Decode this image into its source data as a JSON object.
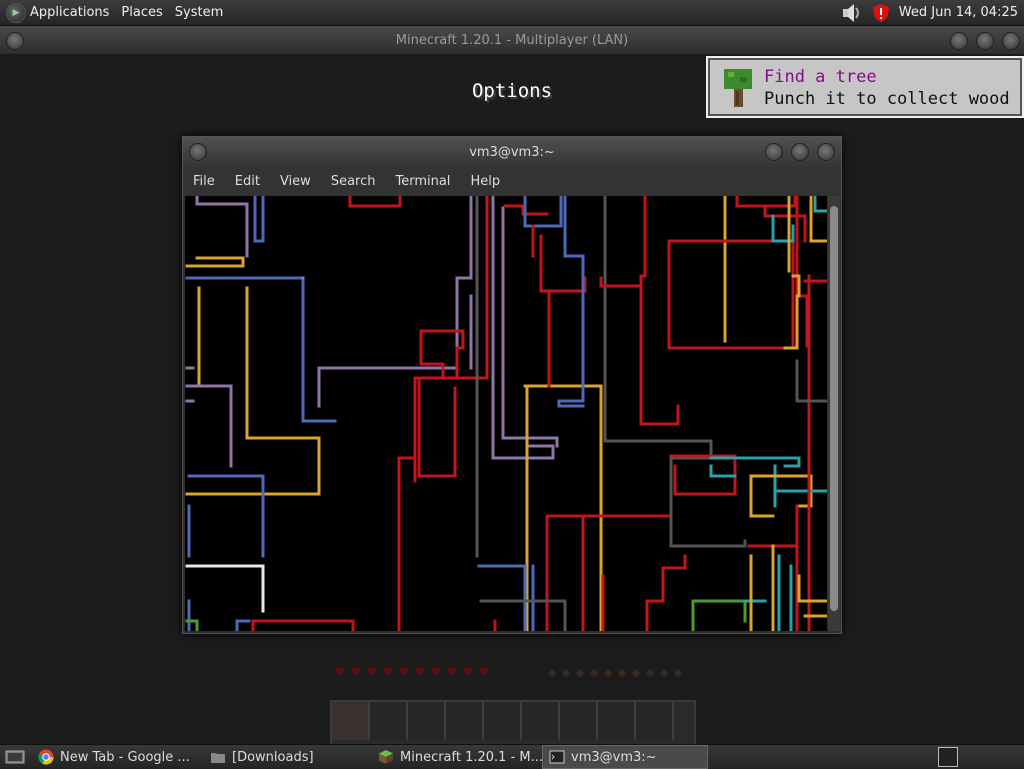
{
  "top_panel": {
    "menus": [
      "Applications",
      "Places",
      "System"
    ],
    "clock": "Wed Jun 14, 04:25",
    "icons": [
      "volume-icon",
      "update-shield-icon"
    ]
  },
  "minecraft_window": {
    "title": "Minecraft 1.20.1 - Multiplayer (LAN)",
    "screen_title": "Options",
    "toast": {
      "title": "Find a tree",
      "subtitle": "Punch it to collect wood"
    },
    "hotbar_slots": 9,
    "colors": {
      "toast_title": "#8a0b8a",
      "bg": "#1d1c1c"
    }
  },
  "terminal": {
    "title": "vm3@vm3:~",
    "menus": [
      "File",
      "Edit",
      "View",
      "Search",
      "Terminal",
      "Help"
    ],
    "colors": [
      "#c0151d",
      "#d8a530",
      "#4d69b8",
      "#8f76a8",
      "#2aa0a8",
      "#e8e8e8",
      "#4e9a2e",
      "#555555"
    ]
  },
  "taskbar": {
    "items": [
      {
        "label": "New Tab - Google ...",
        "icon": "chrome-icon",
        "active": false
      },
      {
        "label": "[Downloads]",
        "icon": "folder-icon",
        "active": false
      },
      {
        "label": "Minecraft 1.20.1 - M...",
        "icon": "minecraft-icon",
        "active": false
      },
      {
        "label": "vm3@vm3:~",
        "icon": "terminal-icon",
        "active": true
      }
    ]
  }
}
